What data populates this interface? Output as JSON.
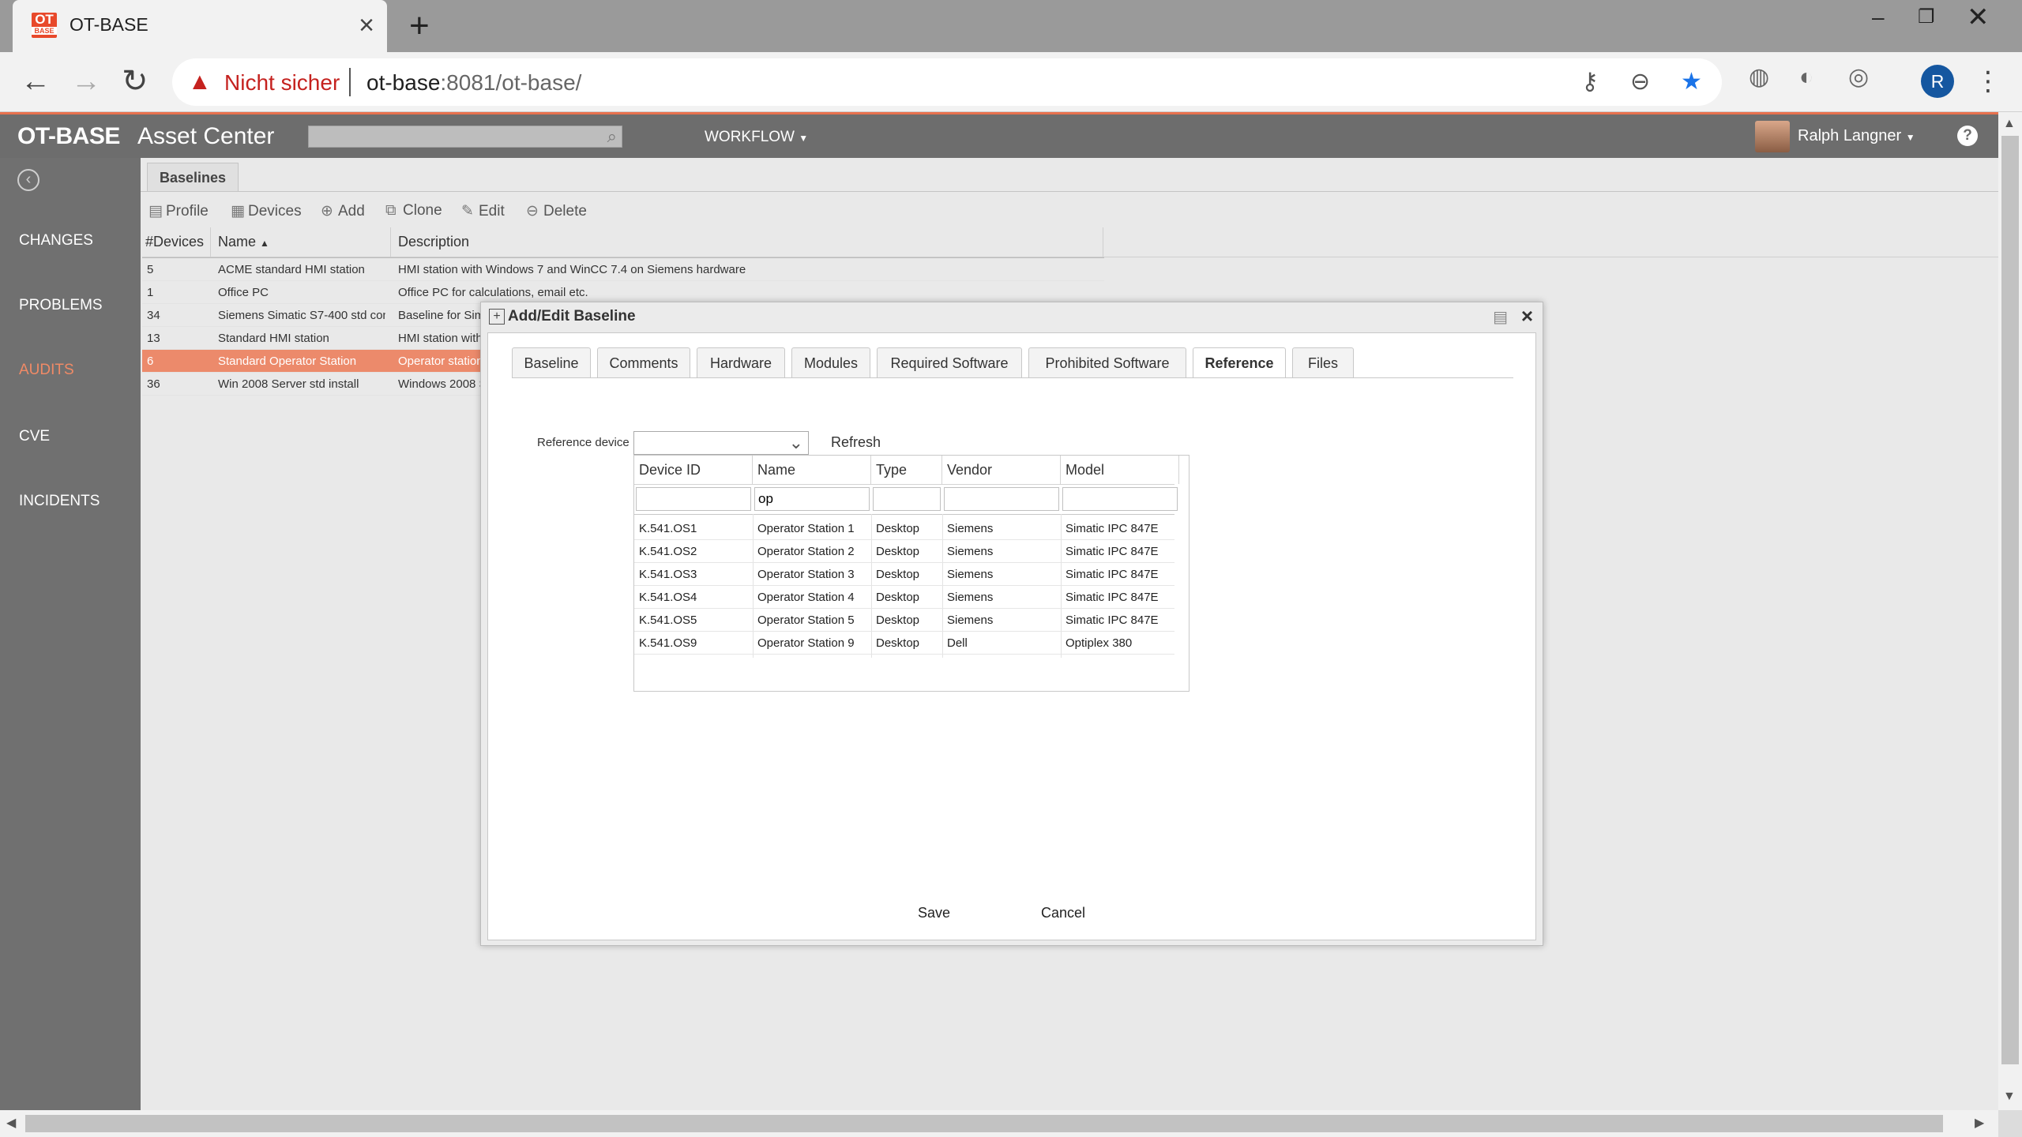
{
  "browser": {
    "tab_title": "OT-BASE",
    "favicon_top": "OT",
    "favicon_bottom": "BASE",
    "security_warning": "Nicht sicher",
    "url_host": "ot-base",
    "url_rest": ":8081/ot-base/",
    "profile_initial": "R"
  },
  "header": {
    "brand": "OT-BASE",
    "subtitle": "Asset Center",
    "workflow_label": "WORKFLOW",
    "user_name": "Ralph Langner",
    "help_label": "?"
  },
  "sidebar": {
    "items": [
      {
        "label": "CHANGES",
        "active": false
      },
      {
        "label": "PROBLEMS",
        "active": false
      },
      {
        "label": "AUDITS",
        "active": true
      },
      {
        "label": "CVE",
        "active": false
      },
      {
        "label": "INCIDENTS",
        "active": false
      }
    ]
  },
  "main": {
    "tab_label": "Baselines",
    "actions": [
      "Profile",
      "Devices",
      "Add",
      "Clone",
      "Edit",
      "Delete"
    ],
    "columns": [
      "#Devices",
      "Name",
      "Description"
    ],
    "rows": [
      {
        "devices": "5",
        "name": "ACME standard HMI station",
        "description": "HMI station with Windows 7 and WinCC 7.4 on Siemens hardware"
      },
      {
        "devices": "1",
        "name": "Office PC",
        "description": "Office PC for calculations, email etc."
      },
      {
        "devices": "34",
        "name": "Siemens Simatic S7-400 std con",
        "description": "Baseline for Sim"
      },
      {
        "devices": "13",
        "name": "Standard HMI station",
        "description": "HMI station with"
      },
      {
        "devices": "6",
        "name": "Standard Operator Station",
        "description": "Operator station"
      },
      {
        "devices": "36",
        "name": "Win 2008 Server std install",
        "description": "Windows 2008 S"
      }
    ]
  },
  "dialog": {
    "title": "Add/Edit Baseline",
    "tabs": [
      "Baseline",
      "Comments",
      "Hardware",
      "Modules",
      "Required Software",
      "Prohibited Software",
      "Reference",
      "Files"
    ],
    "active_tab": "Reference",
    "reference_label": "Reference device",
    "reference_value": "",
    "refresh_label": "Refresh",
    "grid_columns": [
      "Device ID",
      "Name",
      "Type",
      "Vendor",
      "Model"
    ],
    "filters": {
      "device_id": "",
      "name": "op",
      "type": "",
      "vendor": "",
      "model": ""
    },
    "grid_rows": [
      {
        "device_id": "K.541.OS1",
        "name": "Operator Station 1",
        "type": "Desktop",
        "vendor": "Siemens",
        "model": "Simatic IPC 847E"
      },
      {
        "device_id": "K.541.OS2",
        "name": "Operator Station 2",
        "type": "Desktop",
        "vendor": "Siemens",
        "model": "Simatic IPC 847E"
      },
      {
        "device_id": "K.541.OS3",
        "name": "Operator Station 3",
        "type": "Desktop",
        "vendor": "Siemens",
        "model": "Simatic IPC 847E"
      },
      {
        "device_id": "K.541.OS4",
        "name": "Operator Station 4",
        "type": "Desktop",
        "vendor": "Siemens",
        "model": "Simatic IPC 847E"
      },
      {
        "device_id": "K.541.OS5",
        "name": "Operator Station 5",
        "type": "Desktop",
        "vendor": "Siemens",
        "model": "Simatic IPC 847E"
      },
      {
        "device_id": "K.541.OS9",
        "name": "Operator Station 9",
        "type": "Desktop",
        "vendor": "Dell",
        "model": "Optiplex 380"
      }
    ],
    "save_label": "Save",
    "cancel_label": "Cancel"
  },
  "colors": {
    "accent": "#e8714e",
    "selected_row": "#ec8a6b",
    "header_bg": "#6d6d6d"
  }
}
